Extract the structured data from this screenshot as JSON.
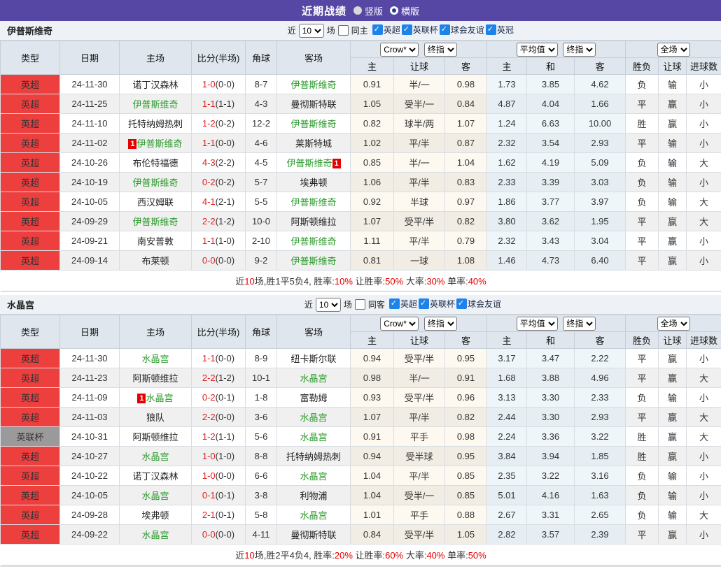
{
  "page": {
    "title": "近期战绩",
    "radio_vertical": "竖版",
    "radio_horizontal": "横版"
  },
  "colors": {
    "topbar_purple": "#5747a5",
    "league_red": "#ee3f3f",
    "league_gray": "#9a9a9a",
    "focus_team_green": "#2a9a2a",
    "score_red": "#e02020",
    "win_red": "#d92b2b",
    "draw_green": "#229922",
    "lose_blue": "#2323cc",
    "summary_red": "#e00000",
    "card_badge_red": "#e60000",
    "checkbox_blue": "#1d83e8"
  },
  "columns": {
    "type": "类型",
    "date": "日期",
    "home": "主场",
    "score": "比分(半场)",
    "corner": "角球",
    "away": "客场",
    "h": "主",
    "handicap": "让球",
    "a": "客",
    "h2": "主",
    "draw": "和",
    "a2": "客",
    "wdl": "胜负",
    "handicap2": "让球",
    "goals": "进球数"
  },
  "sections": [
    {
      "team": "伊普斯维奇",
      "filter": {
        "near": "近",
        "count": "10",
        "games": "场",
        "same": "同主",
        "leagues": [
          "英超",
          "英联杯",
          "球会友谊",
          "英冠"
        ]
      },
      "dropdowns": {
        "source": "Crow*",
        "kind1": "终指",
        "avg": "平均值",
        "kind2": "终指",
        "scope": "全场"
      },
      "rows": [
        {
          "lg": "英超",
          "lgc": "red",
          "date": "24-11-30",
          "home": "诺丁汉森林",
          "hg": false,
          "hc": false,
          "ft": "1-0",
          "ht": "(0-0)",
          "cn": "8-7",
          "away": "伊普斯维奇",
          "ag": true,
          "ac": false,
          "o": [
            "0.91",
            "半/一",
            "0.98"
          ],
          "v": [
            "1.73",
            "3.85",
            "4.62"
          ],
          "r": [
            "负",
            "输",
            "小"
          ]
        },
        {
          "lg": "英超",
          "lgc": "red",
          "date": "24-11-25",
          "home": "伊普斯维奇",
          "hg": true,
          "hc": false,
          "ft": "1-1",
          "ht": "(1-1)",
          "cn": "4-3",
          "away": "曼彻斯特联",
          "ag": false,
          "ac": false,
          "o": [
            "1.05",
            "受半/一",
            "0.84"
          ],
          "v": [
            "4.87",
            "4.04",
            "1.66"
          ],
          "r": [
            "平",
            "赢",
            "小"
          ]
        },
        {
          "lg": "英超",
          "lgc": "red",
          "date": "24-11-10",
          "home": "托特纳姆热刺",
          "hg": false,
          "hc": false,
          "ft": "1-2",
          "ht": "(0-2)",
          "cn": "12-2",
          "away": "伊普斯维奇",
          "ag": true,
          "ac": false,
          "o": [
            "0.82",
            "球半/两",
            "1.07"
          ],
          "v": [
            "1.24",
            "6.63",
            "10.00"
          ],
          "r": [
            "胜",
            "赢",
            "小"
          ]
        },
        {
          "lg": "英超",
          "lgc": "red",
          "date": "24-11-02",
          "home": "伊普斯维奇",
          "hg": true,
          "hc": true,
          "ft": "1-1",
          "ht": "(0-0)",
          "cn": "4-6",
          "away": "莱斯特城",
          "ag": false,
          "ac": false,
          "o": [
            "1.02",
            "平/半",
            "0.87"
          ],
          "v": [
            "2.32",
            "3.54",
            "2.93"
          ],
          "r": [
            "平",
            "输",
            "小"
          ]
        },
        {
          "lg": "英超",
          "lgc": "red",
          "date": "24-10-26",
          "home": "布伦特福德",
          "hg": false,
          "hc": false,
          "ft": "4-3",
          "ht": "(2-2)",
          "cn": "4-5",
          "away": "伊普斯维奇",
          "ag": true,
          "ac": true,
          "o": [
            "0.85",
            "半/一",
            "1.04"
          ],
          "v": [
            "1.62",
            "4.19",
            "5.09"
          ],
          "r": [
            "负",
            "输",
            "大"
          ]
        },
        {
          "lg": "英超",
          "lgc": "red",
          "date": "24-10-19",
          "home": "伊普斯维奇",
          "hg": true,
          "hc": false,
          "ft": "0-2",
          "ht": "(0-2)",
          "cn": "5-7",
          "away": "埃弗顿",
          "ag": false,
          "ac": false,
          "o": [
            "1.06",
            "平/半",
            "0.83"
          ],
          "v": [
            "2.33",
            "3.39",
            "3.03"
          ],
          "r": [
            "负",
            "输",
            "小"
          ]
        },
        {
          "lg": "英超",
          "lgc": "red",
          "date": "24-10-05",
          "home": "西汉姆联",
          "hg": false,
          "hc": false,
          "ft": "4-1",
          "ht": "(2-1)",
          "cn": "5-5",
          "away": "伊普斯维奇",
          "ag": true,
          "ac": false,
          "o": [
            "0.92",
            "半球",
            "0.97"
          ],
          "v": [
            "1.86",
            "3.77",
            "3.97"
          ],
          "r": [
            "负",
            "输",
            "大"
          ]
        },
        {
          "lg": "英超",
          "lgc": "red",
          "date": "24-09-29",
          "home": "伊普斯维奇",
          "hg": true,
          "hc": false,
          "ft": "2-2",
          "ht": "(1-2)",
          "cn": "10-0",
          "away": "阿斯顿维拉",
          "ag": false,
          "ac": false,
          "o": [
            "1.07",
            "受平/半",
            "0.82"
          ],
          "v": [
            "3.80",
            "3.62",
            "1.95"
          ],
          "r": [
            "平",
            "赢",
            "大"
          ]
        },
        {
          "lg": "英超",
          "lgc": "red",
          "date": "24-09-21",
          "home": "南安普敦",
          "hg": false,
          "hc": false,
          "ft": "1-1",
          "ht": "(1-0)",
          "cn": "2-10",
          "away": "伊普斯维奇",
          "ag": true,
          "ac": false,
          "o": [
            "1.11",
            "平/半",
            "0.79"
          ],
          "v": [
            "2.32",
            "3.43",
            "3.04"
          ],
          "r": [
            "平",
            "赢",
            "小"
          ]
        },
        {
          "lg": "英超",
          "lgc": "red",
          "date": "24-09-14",
          "home": "布莱顿",
          "hg": false,
          "hc": false,
          "ft": "0-0",
          "ht": "(0-0)",
          "cn": "9-2",
          "away": "伊普斯维奇",
          "ag": true,
          "ac": false,
          "o": [
            "0.81",
            "一球",
            "1.08"
          ],
          "v": [
            "1.46",
            "4.73",
            "6.40"
          ],
          "r": [
            "平",
            "赢",
            "小"
          ]
        }
      ],
      "summary": [
        {
          "t": "近",
          "c": "k"
        },
        {
          "t": "10",
          "c": "r"
        },
        {
          "t": "场,胜1平5负4, 胜率:",
          "c": "k"
        },
        {
          "t": "10%",
          "c": "r"
        },
        {
          "t": " 让胜率:",
          "c": "k"
        },
        {
          "t": "50%",
          "c": "r"
        },
        {
          "t": " 大率:",
          "c": "k"
        },
        {
          "t": "30%",
          "c": "r"
        },
        {
          "t": " 单率:",
          "c": "k"
        },
        {
          "t": "40%",
          "c": "r"
        }
      ]
    },
    {
      "team": "水晶宫",
      "filter": {
        "near": "近",
        "count": "10",
        "games": "场",
        "same": "同客",
        "leagues": [
          "英超",
          "英联杯",
          "球会友谊"
        ]
      },
      "dropdowns": {
        "source": "Crow*",
        "kind1": "终指",
        "avg": "平均值",
        "kind2": "终指",
        "scope": "全场"
      },
      "rows": [
        {
          "lg": "英超",
          "lgc": "red",
          "date": "24-11-30",
          "home": "水晶宫",
          "hg": true,
          "hc": false,
          "ft": "1-1",
          "ht": "(0-0)",
          "cn": "8-9",
          "away": "纽卡斯尔联",
          "ag": false,
          "ac": false,
          "o": [
            "0.94",
            "受平/半",
            "0.95"
          ],
          "v": [
            "3.17",
            "3.47",
            "2.22"
          ],
          "r": [
            "平",
            "赢",
            "小"
          ]
        },
        {
          "lg": "英超",
          "lgc": "red",
          "date": "24-11-23",
          "home": "阿斯顿维拉",
          "hg": false,
          "hc": false,
          "ft": "2-2",
          "ht": "(1-2)",
          "cn": "10-1",
          "away": "水晶宫",
          "ag": true,
          "ac": false,
          "o": [
            "0.98",
            "半/一",
            "0.91"
          ],
          "v": [
            "1.68",
            "3.88",
            "4.96"
          ],
          "r": [
            "平",
            "赢",
            "大"
          ]
        },
        {
          "lg": "英超",
          "lgc": "red",
          "date": "24-11-09",
          "home": "水晶宫",
          "hg": true,
          "hc": true,
          "ft": "0-2",
          "ht": "(0-1)",
          "cn": "1-8",
          "away": "富勒姆",
          "ag": false,
          "ac": false,
          "o": [
            "0.93",
            "受平/半",
            "0.96"
          ],
          "v": [
            "3.13",
            "3.30",
            "2.33"
          ],
          "r": [
            "负",
            "输",
            "小"
          ]
        },
        {
          "lg": "英超",
          "lgc": "red",
          "date": "24-11-03",
          "home": "狼队",
          "hg": false,
          "hc": false,
          "ft": "2-2",
          "ht": "(0-0)",
          "cn": "3-6",
          "away": "水晶宫",
          "ag": true,
          "ac": false,
          "o": [
            "1.07",
            "平/半",
            "0.82"
          ],
          "v": [
            "2.44",
            "3.30",
            "2.93"
          ],
          "r": [
            "平",
            "赢",
            "大"
          ]
        },
        {
          "lg": "英联杯",
          "lgc": "gray",
          "date": "24-10-31",
          "home": "阿斯顿维拉",
          "hg": false,
          "hc": false,
          "ft": "1-2",
          "ht": "(1-1)",
          "cn": "5-6",
          "away": "水晶宫",
          "ag": true,
          "ac": false,
          "o": [
            "0.91",
            "平手",
            "0.98"
          ],
          "v": [
            "2.24",
            "3.36",
            "3.22"
          ],
          "r": [
            "胜",
            "赢",
            "大"
          ]
        },
        {
          "lg": "英超",
          "lgc": "red",
          "date": "24-10-27",
          "home": "水晶宫",
          "hg": true,
          "hc": false,
          "ft": "1-0",
          "ht": "(1-0)",
          "cn": "8-8",
          "away": "托特纳姆热刺",
          "ag": false,
          "ac": false,
          "o": [
            "0.94",
            "受半球",
            "0.95"
          ],
          "v": [
            "3.84",
            "3.94",
            "1.85"
          ],
          "r": [
            "胜",
            "赢",
            "小"
          ]
        },
        {
          "lg": "英超",
          "lgc": "red",
          "date": "24-10-22",
          "home": "诺丁汉森林",
          "hg": false,
          "hc": false,
          "ft": "1-0",
          "ht": "(0-0)",
          "cn": "6-6",
          "away": "水晶宫",
          "ag": true,
          "ac": false,
          "o": [
            "1.04",
            "平/半",
            "0.85"
          ],
          "v": [
            "2.35",
            "3.22",
            "3.16"
          ],
          "r": [
            "负",
            "输",
            "小"
          ]
        },
        {
          "lg": "英超",
          "lgc": "red",
          "date": "24-10-05",
          "home": "水晶宫",
          "hg": true,
          "hc": false,
          "ft": "0-1",
          "ht": "(0-1)",
          "cn": "3-8",
          "away": "利物浦",
          "ag": false,
          "ac": false,
          "o": [
            "1.04",
            "受半/一",
            "0.85"
          ],
          "v": [
            "5.01",
            "4.16",
            "1.63"
          ],
          "r": [
            "负",
            "输",
            "小"
          ]
        },
        {
          "lg": "英超",
          "lgc": "red",
          "date": "24-09-28",
          "home": "埃弗顿",
          "hg": false,
          "hc": false,
          "ft": "2-1",
          "ht": "(0-1)",
          "cn": "5-8",
          "away": "水晶宫",
          "ag": true,
          "ac": false,
          "o": [
            "1.01",
            "平手",
            "0.88"
          ],
          "v": [
            "2.67",
            "3.31",
            "2.65"
          ],
          "r": [
            "负",
            "输",
            "大"
          ]
        },
        {
          "lg": "英超",
          "lgc": "red",
          "date": "24-09-22",
          "home": "水晶宫",
          "hg": true,
          "hc": false,
          "ft": "0-0",
          "ht": "(0-0)",
          "cn": "4-11",
          "away": "曼彻斯特联",
          "ag": false,
          "ac": false,
          "o": [
            "0.84",
            "受平/半",
            "1.05"
          ],
          "v": [
            "2.82",
            "3.57",
            "2.39"
          ],
          "r": [
            "平",
            "赢",
            "小"
          ]
        }
      ],
      "summary": [
        {
          "t": "近",
          "c": "k"
        },
        {
          "t": "10",
          "c": "r"
        },
        {
          "t": "场,胜2平4负4, 胜率:",
          "c": "k"
        },
        {
          "t": "20%",
          "c": "r"
        },
        {
          "t": " 让胜率:",
          "c": "k"
        },
        {
          "t": "60%",
          "c": "r"
        },
        {
          "t": " 大率:",
          "c": "k"
        },
        {
          "t": "40%",
          "c": "r"
        },
        {
          "t": " 单率:",
          "c": "k"
        },
        {
          "t": "50%",
          "c": "r"
        }
      ]
    }
  ]
}
